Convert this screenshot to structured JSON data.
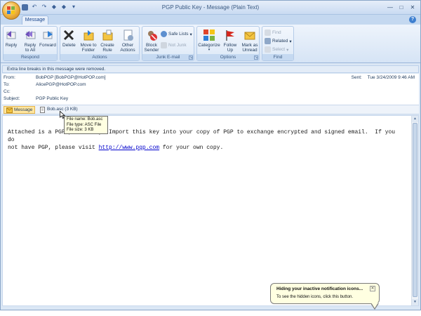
{
  "window": {
    "title": "PGP Public Key - Message (Plain Text)"
  },
  "tabs": [
    {
      "label": "Message"
    }
  ],
  "ribbon": {
    "groups": [
      {
        "label": "Respond",
        "buttons": [
          "Reply",
          "Reply to All",
          "Forward"
        ]
      },
      {
        "label": "Actions",
        "buttons": [
          "Delete",
          "Move to Folder",
          "Create Rule",
          "Other Actions"
        ]
      },
      {
        "label": "Junk E-mail",
        "buttons": [
          "Block Sender",
          "Safe Lists",
          "Not Junk"
        ]
      },
      {
        "label": "Options",
        "buttons": [
          "Categorize",
          "Follow Up",
          "Mark as Unread"
        ]
      },
      {
        "label": "Find",
        "buttons": [
          "Find",
          "Related",
          "Select"
        ]
      }
    ]
  },
  "infobar": {
    "text": "Extra line breaks in this message were removed."
  },
  "header": {
    "from_label": "From:",
    "from": "BobPGP [BobPGP@HotPOP.com]",
    "to_label": "To:",
    "to": "AlicePGP@HotPOP.com",
    "cc_label": "Cc:",
    "cc": "",
    "subject_label": "Subject:",
    "subject": "PGP Public Key",
    "sent_label": "Sent:",
    "sent": "Tue 3/24/2009 9:46 AM"
  },
  "attachments": {
    "message_tab": "Message",
    "file": "Bob.asc (3 KB)"
  },
  "tooltip": {
    "line1": "File name:  Bob.asc",
    "line2": "File type:  ASC File",
    "line3": "File size:  3 KB"
  },
  "body": {
    "text_before": "Attached is a PGP public key. Import this key into your copy of PGP to exchange encrypted and signed email.  If you do\nnot have PGP, please visit ",
    "link": "http://www.pgp.com",
    "text_after": " for your own copy."
  },
  "notification": {
    "title": "Hiding your inactive notification icons...",
    "text": "To see the hidden icons, click this button."
  }
}
